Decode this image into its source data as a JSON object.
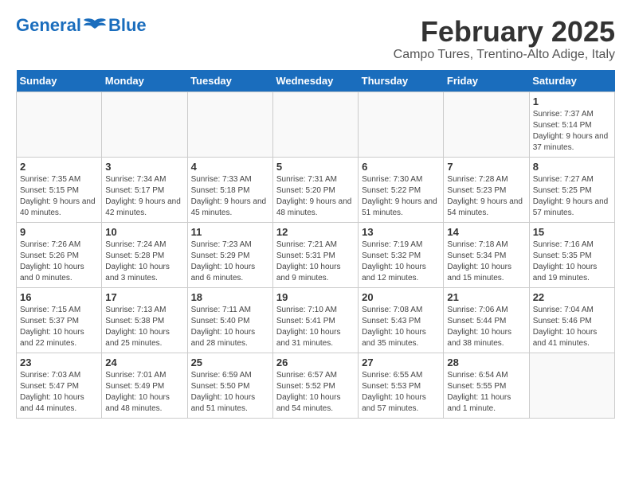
{
  "header": {
    "logo_line1": "General",
    "logo_line2": "Blue",
    "title": "February 2025",
    "subtitle": "Campo Tures, Trentino-Alto Adige, Italy"
  },
  "days_of_week": [
    "Sunday",
    "Monday",
    "Tuesday",
    "Wednesday",
    "Thursday",
    "Friday",
    "Saturday"
  ],
  "weeks": [
    [
      {
        "day": "",
        "info": ""
      },
      {
        "day": "",
        "info": ""
      },
      {
        "day": "",
        "info": ""
      },
      {
        "day": "",
        "info": ""
      },
      {
        "day": "",
        "info": ""
      },
      {
        "day": "",
        "info": ""
      },
      {
        "day": "1",
        "info": "Sunrise: 7:37 AM\nSunset: 5:14 PM\nDaylight: 9 hours and 37 minutes."
      }
    ],
    [
      {
        "day": "2",
        "info": "Sunrise: 7:35 AM\nSunset: 5:15 PM\nDaylight: 9 hours and 40 minutes."
      },
      {
        "day": "3",
        "info": "Sunrise: 7:34 AM\nSunset: 5:17 PM\nDaylight: 9 hours and 42 minutes."
      },
      {
        "day": "4",
        "info": "Sunrise: 7:33 AM\nSunset: 5:18 PM\nDaylight: 9 hours and 45 minutes."
      },
      {
        "day": "5",
        "info": "Sunrise: 7:31 AM\nSunset: 5:20 PM\nDaylight: 9 hours and 48 minutes."
      },
      {
        "day": "6",
        "info": "Sunrise: 7:30 AM\nSunset: 5:22 PM\nDaylight: 9 hours and 51 minutes."
      },
      {
        "day": "7",
        "info": "Sunrise: 7:28 AM\nSunset: 5:23 PM\nDaylight: 9 hours and 54 minutes."
      },
      {
        "day": "8",
        "info": "Sunrise: 7:27 AM\nSunset: 5:25 PM\nDaylight: 9 hours and 57 minutes."
      }
    ],
    [
      {
        "day": "9",
        "info": "Sunrise: 7:26 AM\nSunset: 5:26 PM\nDaylight: 10 hours and 0 minutes."
      },
      {
        "day": "10",
        "info": "Sunrise: 7:24 AM\nSunset: 5:28 PM\nDaylight: 10 hours and 3 minutes."
      },
      {
        "day": "11",
        "info": "Sunrise: 7:23 AM\nSunset: 5:29 PM\nDaylight: 10 hours and 6 minutes."
      },
      {
        "day": "12",
        "info": "Sunrise: 7:21 AM\nSunset: 5:31 PM\nDaylight: 10 hours and 9 minutes."
      },
      {
        "day": "13",
        "info": "Sunrise: 7:19 AM\nSunset: 5:32 PM\nDaylight: 10 hours and 12 minutes."
      },
      {
        "day": "14",
        "info": "Sunrise: 7:18 AM\nSunset: 5:34 PM\nDaylight: 10 hours and 15 minutes."
      },
      {
        "day": "15",
        "info": "Sunrise: 7:16 AM\nSunset: 5:35 PM\nDaylight: 10 hours and 19 minutes."
      }
    ],
    [
      {
        "day": "16",
        "info": "Sunrise: 7:15 AM\nSunset: 5:37 PM\nDaylight: 10 hours and 22 minutes."
      },
      {
        "day": "17",
        "info": "Sunrise: 7:13 AM\nSunset: 5:38 PM\nDaylight: 10 hours and 25 minutes."
      },
      {
        "day": "18",
        "info": "Sunrise: 7:11 AM\nSunset: 5:40 PM\nDaylight: 10 hours and 28 minutes."
      },
      {
        "day": "19",
        "info": "Sunrise: 7:10 AM\nSunset: 5:41 PM\nDaylight: 10 hours and 31 minutes."
      },
      {
        "day": "20",
        "info": "Sunrise: 7:08 AM\nSunset: 5:43 PM\nDaylight: 10 hours and 35 minutes."
      },
      {
        "day": "21",
        "info": "Sunrise: 7:06 AM\nSunset: 5:44 PM\nDaylight: 10 hours and 38 minutes."
      },
      {
        "day": "22",
        "info": "Sunrise: 7:04 AM\nSunset: 5:46 PM\nDaylight: 10 hours and 41 minutes."
      }
    ],
    [
      {
        "day": "23",
        "info": "Sunrise: 7:03 AM\nSunset: 5:47 PM\nDaylight: 10 hours and 44 minutes."
      },
      {
        "day": "24",
        "info": "Sunrise: 7:01 AM\nSunset: 5:49 PM\nDaylight: 10 hours and 48 minutes."
      },
      {
        "day": "25",
        "info": "Sunrise: 6:59 AM\nSunset: 5:50 PM\nDaylight: 10 hours and 51 minutes."
      },
      {
        "day": "26",
        "info": "Sunrise: 6:57 AM\nSunset: 5:52 PM\nDaylight: 10 hours and 54 minutes."
      },
      {
        "day": "27",
        "info": "Sunrise: 6:55 AM\nSunset: 5:53 PM\nDaylight: 10 hours and 57 minutes."
      },
      {
        "day": "28",
        "info": "Sunrise: 6:54 AM\nSunset: 5:55 PM\nDaylight: 11 hours and 1 minute."
      },
      {
        "day": "",
        "info": ""
      }
    ]
  ]
}
